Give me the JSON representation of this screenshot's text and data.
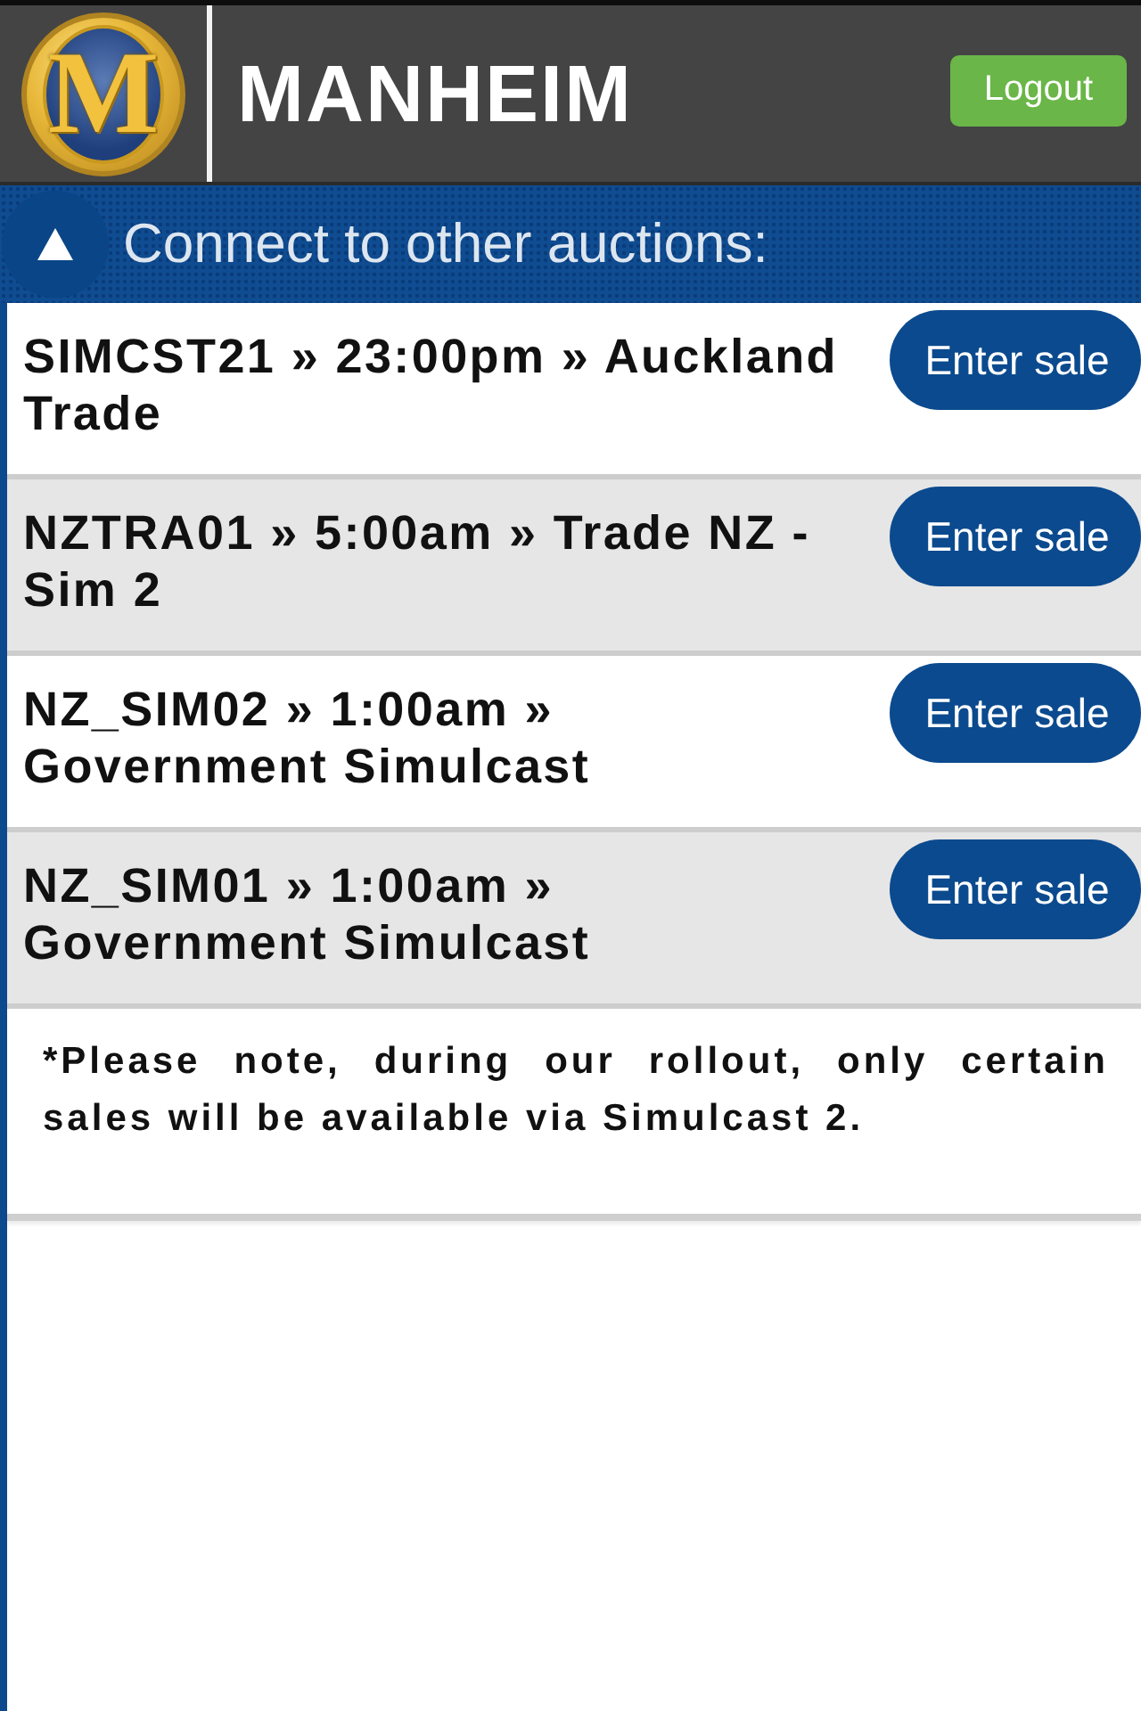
{
  "header": {
    "logo_mark": "M",
    "brand": "MANHEIM",
    "logout_button": "Logout"
  },
  "section": {
    "title": "Connect to other auctions:",
    "expanded": true
  },
  "sales": [
    {
      "label": "SIMCST21 » 23:00pm » Auckland Trade",
      "button": "Enter sale"
    },
    {
      "label": "NZTRA01 » 5:00am » Trade NZ - Sim 2",
      "button": "Enter sale"
    },
    {
      "label": "NZ_SIM02 » 1:00am » Government Simulcast",
      "button": "Enter sale"
    },
    {
      "label": "NZ_SIM01 » 1:00am » Government Simulcast",
      "button": "Enter sale"
    }
  ],
  "note": "*Please note, during our rollout, only certain sales will be available via Simulcast 2."
}
